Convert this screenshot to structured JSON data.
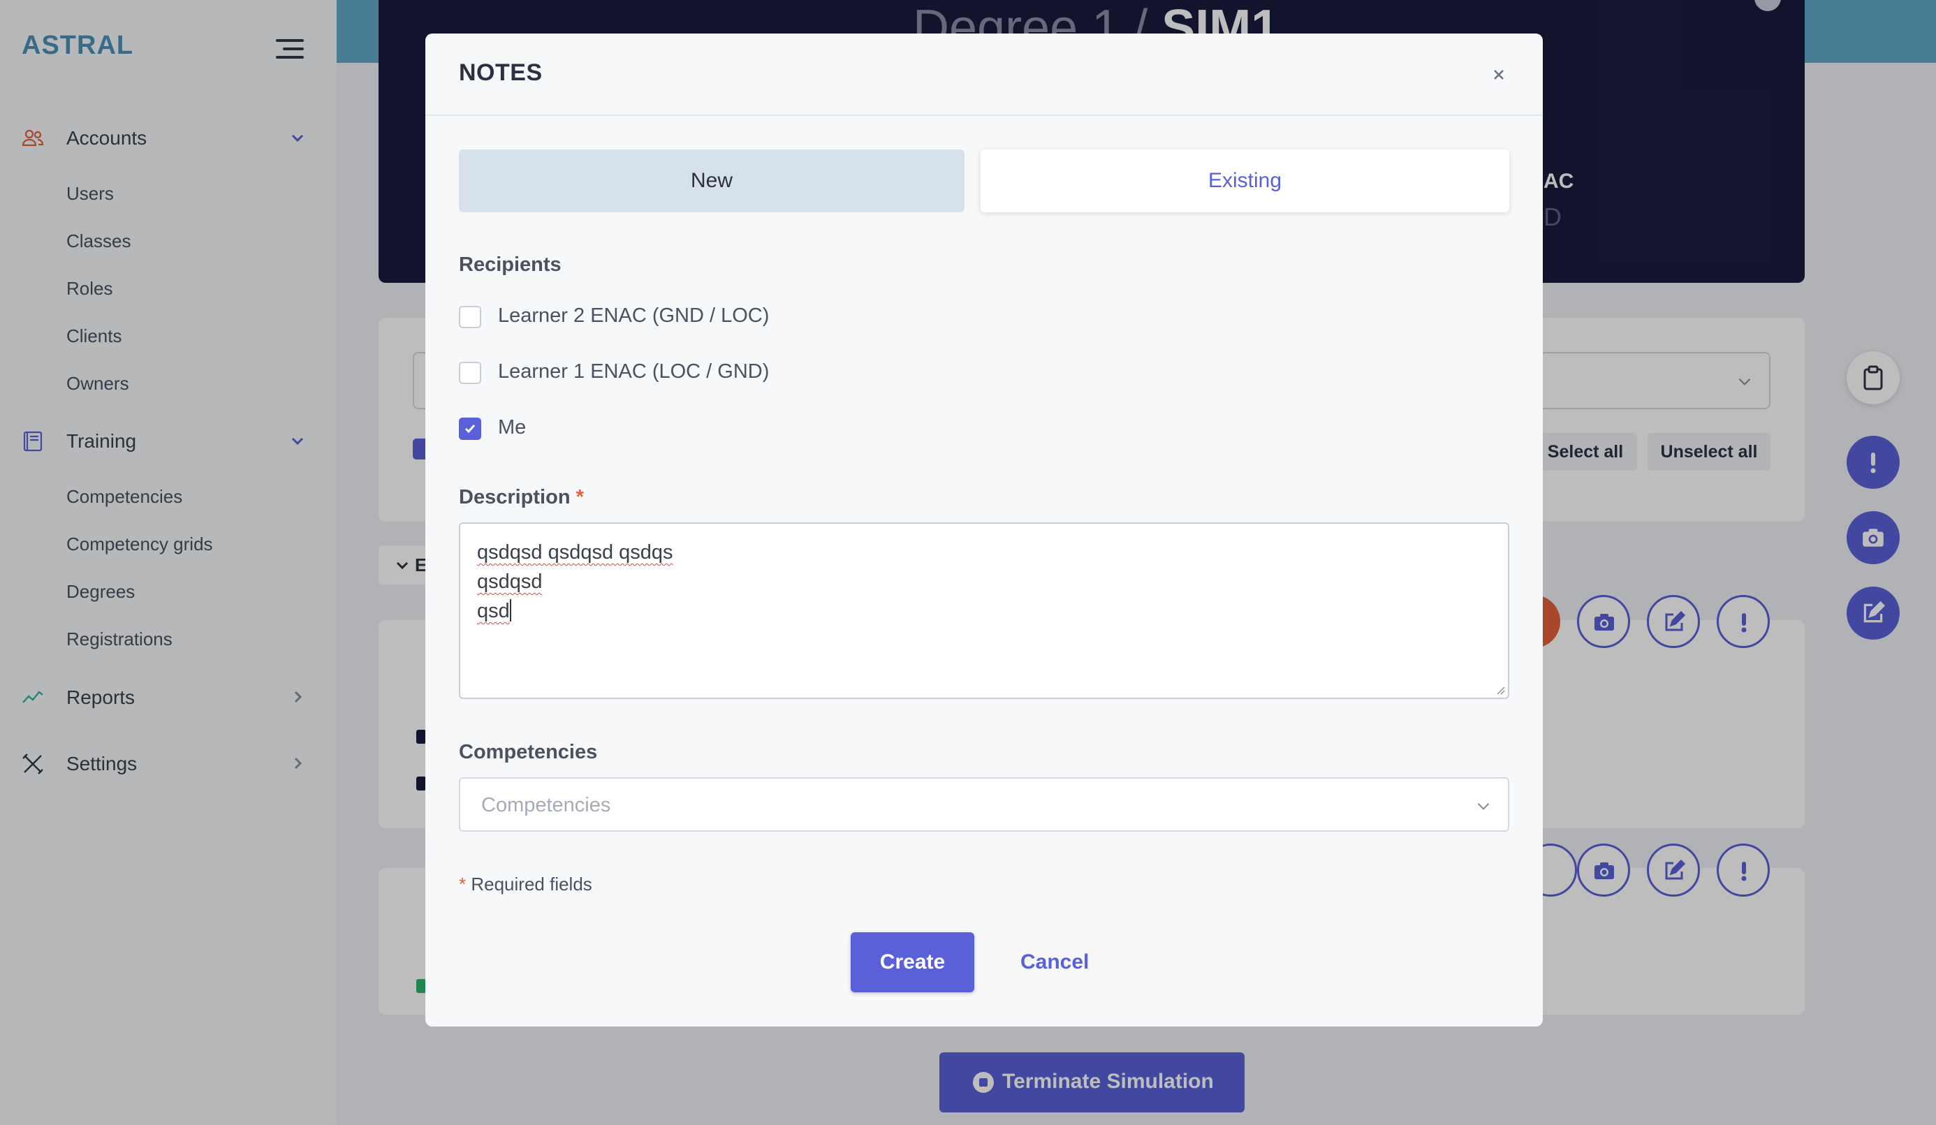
{
  "sidebar": {
    "brand": "ASTRAL",
    "groups": [
      {
        "label": "Accounts",
        "icon": "users-icon",
        "items": [
          "Users",
          "Classes",
          "Roles",
          "Clients",
          "Owners"
        ]
      },
      {
        "label": "Training",
        "icon": "book-icon",
        "items": [
          "Competencies",
          "Competency grids",
          "Degrees",
          "Registrations"
        ]
      },
      {
        "label": "Reports",
        "icon": "chart-line-icon",
        "items": []
      },
      {
        "label": "Settings",
        "icon": "tools-icon",
        "items": []
      }
    ]
  },
  "page": {
    "title_prefix": "Degree 1 / ",
    "title_strong": "SIM1",
    "header_fragment_1": "AC",
    "header_fragment_2": "D",
    "select_all": "Select all",
    "unselect_all": "Unselect all",
    "expand_fragment": "E",
    "terminate": "Terminate Simulation"
  },
  "modal": {
    "title": "NOTES",
    "tabs": {
      "new": "New",
      "existing": "Existing",
      "active": "New"
    },
    "recipients_label": "Recipients",
    "recipients": [
      {
        "label": "Learner 2 ENAC (GND / LOC)",
        "checked": false
      },
      {
        "label": "Learner 1 ENAC (LOC / GND)",
        "checked": false
      },
      {
        "label": "Me",
        "checked": true
      }
    ],
    "description_label": "Description",
    "required_mark": "*",
    "description_lines": [
      "qsdqsd qsdqsd qsdqs",
      "qsdqsd",
      "qsd"
    ],
    "competencies_label": "Competencies",
    "competencies_placeholder": "Competencies",
    "required_note": "Required fields",
    "create": "Create",
    "cancel": "Cancel"
  },
  "colors": {
    "accent": "#5a60d8",
    "brand": "#4f91b5",
    "header_dark": "#191c3f",
    "required": "#e5603b"
  }
}
